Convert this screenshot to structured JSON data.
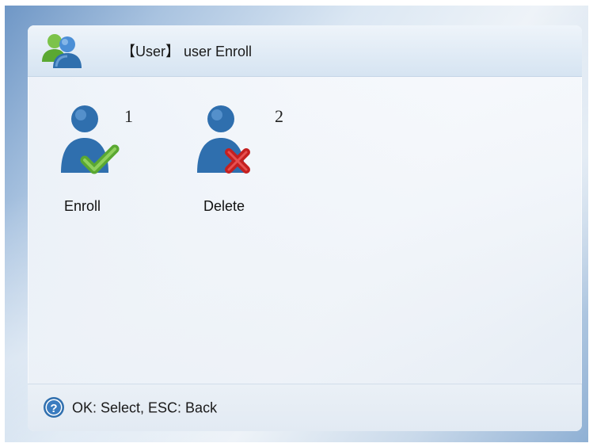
{
  "header": {
    "title": "【User】 user Enroll",
    "icon": "users-icon"
  },
  "menu": {
    "items": [
      {
        "number": "1",
        "label": "Enroll",
        "icon": "user-check-icon"
      },
      {
        "number": "2",
        "label": "Delete",
        "icon": "user-delete-icon"
      }
    ]
  },
  "footer": {
    "hint": "OK: Select, ESC: Back",
    "icon": "help-icon"
  },
  "colors": {
    "user_blue": "#2f6fae",
    "check_green": "#5aa832",
    "delete_red": "#c42020"
  }
}
